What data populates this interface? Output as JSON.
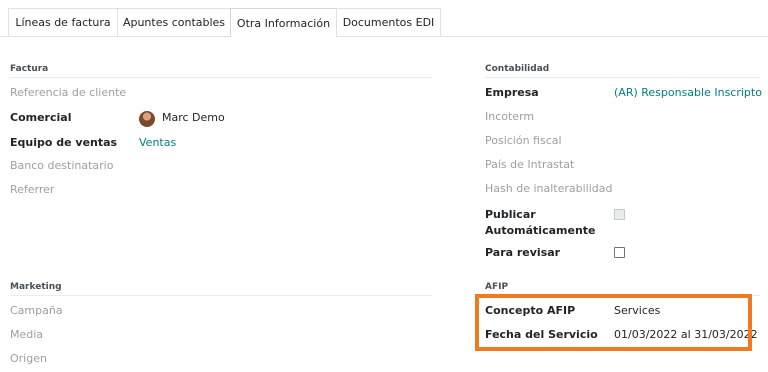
{
  "tabs": [
    {
      "label": "Líneas de factura"
    },
    {
      "label": "Apuntes contables"
    },
    {
      "label": "Otra Información"
    },
    {
      "label": "Documentos EDI"
    }
  ],
  "factura": {
    "title": "Factura",
    "referencia_cliente": "Referencia de cliente",
    "comercial_label": "Comercial",
    "comercial_value": "Marc Demo",
    "equipo_label": "Equipo de ventas",
    "equipo_value": "Ventas",
    "banco_label": "Banco destinatario",
    "referrer_label": "Referrer"
  },
  "marketing": {
    "title": "Marketing",
    "campana": "Campaña",
    "media": "Media",
    "origen": "Origen"
  },
  "contabilidad": {
    "title": "Contabilidad",
    "empresa_label": "Empresa",
    "empresa_value": "(AR) Responsable Inscripto",
    "incoterm": "Incoterm",
    "posicion_fiscal": "Posición fiscal",
    "pais_intrastat": "País de Intrastat",
    "hash": "Hash de inalterabilidad",
    "publicar_line1": "Publicar",
    "publicar_line2": "Automáticamente",
    "para_revisar": "Para revisar"
  },
  "afip": {
    "title": "AFIP",
    "concepto_label": "Concepto AFIP",
    "concepto_value": "Services",
    "fecha_label": "Fecha del Servicio",
    "fecha_value": "01/03/2022 al 31/03/2022"
  },
  "colors": {
    "highlight": "#f07a1f",
    "link": "#017e84"
  }
}
